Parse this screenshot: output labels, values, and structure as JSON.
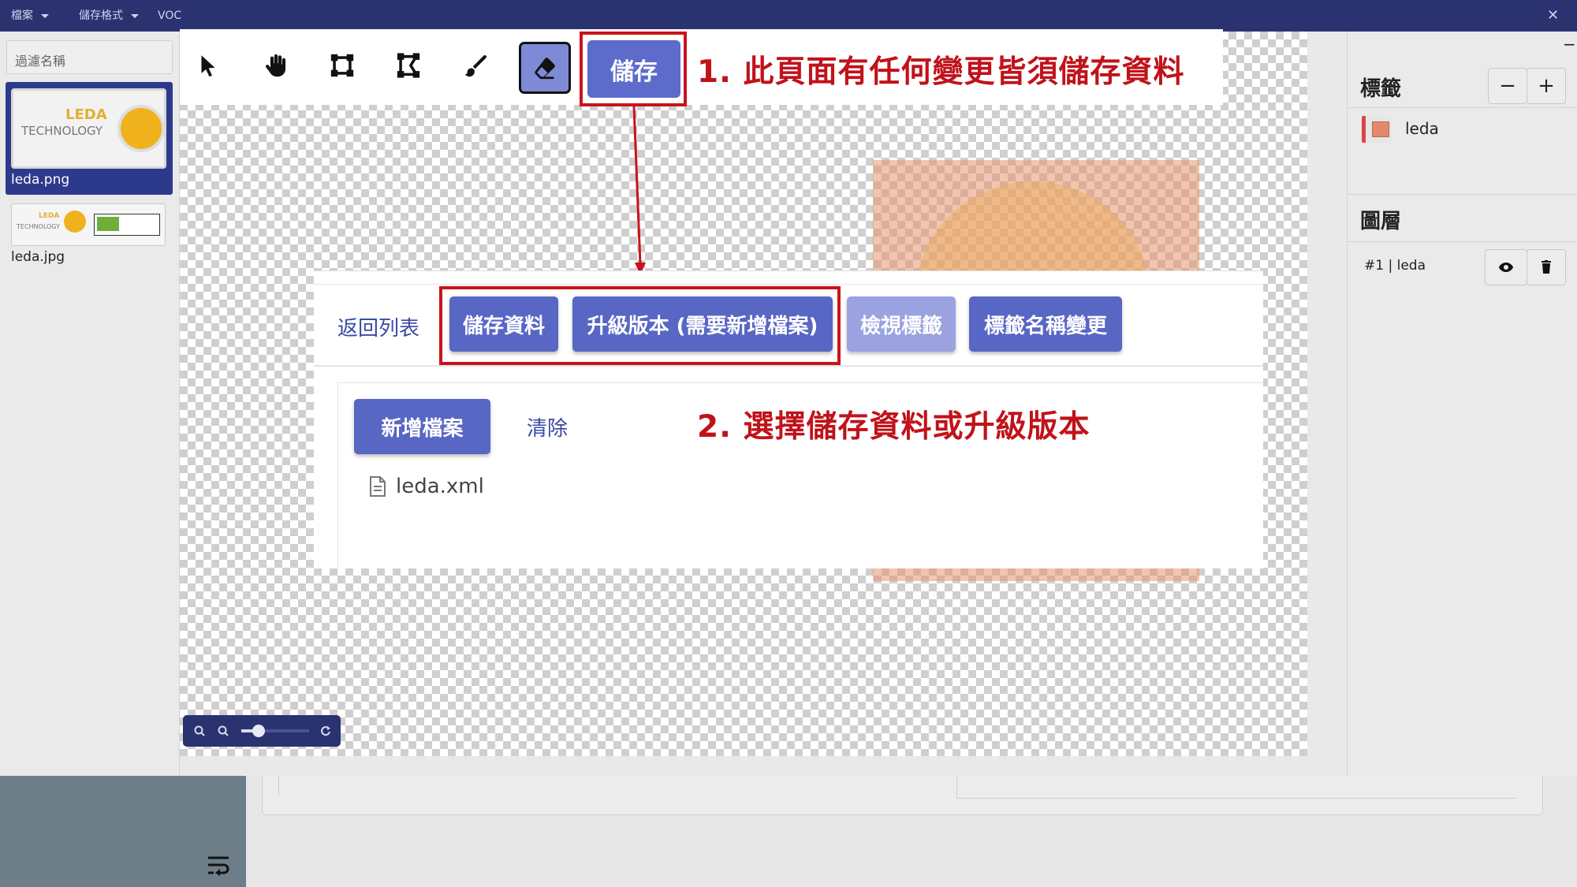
{
  "menu": {
    "file_label": "檔案",
    "save_format_label": "儲存格式",
    "format_value": "VOC",
    "close_symbol": "✕"
  },
  "sidebar": {
    "filter_placeholder": "過濾名稱",
    "files": [
      {
        "name": "leda.png",
        "thumb_text_1": "LEDA",
        "thumb_text_2": "TECHNOLOGY"
      },
      {
        "name": "leda.jpg",
        "thumb_text_1": "LEDA",
        "thumb_text_2": "TECHNOLOGY"
      }
    ]
  },
  "toolbar": {
    "tools": [
      "cursor-icon",
      "hand-icon",
      "rectangle-icon",
      "polygon-icon",
      "brush-icon",
      "eraser-icon"
    ],
    "save_label": "儲存"
  },
  "annotations": {
    "note1": "1. 此頁面有任何變更皆須儲存資料",
    "note2": "2. 選擇儲存資料或升級版本",
    "highlight_color": "#c8141c"
  },
  "dialog": {
    "back_label": "返回列表",
    "buttons": [
      {
        "label": "儲存資料"
      },
      {
        "label": "升級版本 (需要新增檔案)"
      },
      {
        "label": "檢視標籤"
      },
      {
        "label": "標籤名稱變更"
      }
    ],
    "new_file_label": "新增檔案",
    "clear_label": "清除",
    "file_name": "leda.xml"
  },
  "right_panel": {
    "labels_title": "標籤",
    "minus_label": "−",
    "plus_label": "+",
    "label_name": "leda",
    "layers_title": "圖層",
    "layer_name": "#1 | leda",
    "collapse_symbol": "−"
  },
  "colors": {
    "topbar": "#2b3270",
    "accent": "#5866c4",
    "annotation_red": "#c1121a"
  }
}
